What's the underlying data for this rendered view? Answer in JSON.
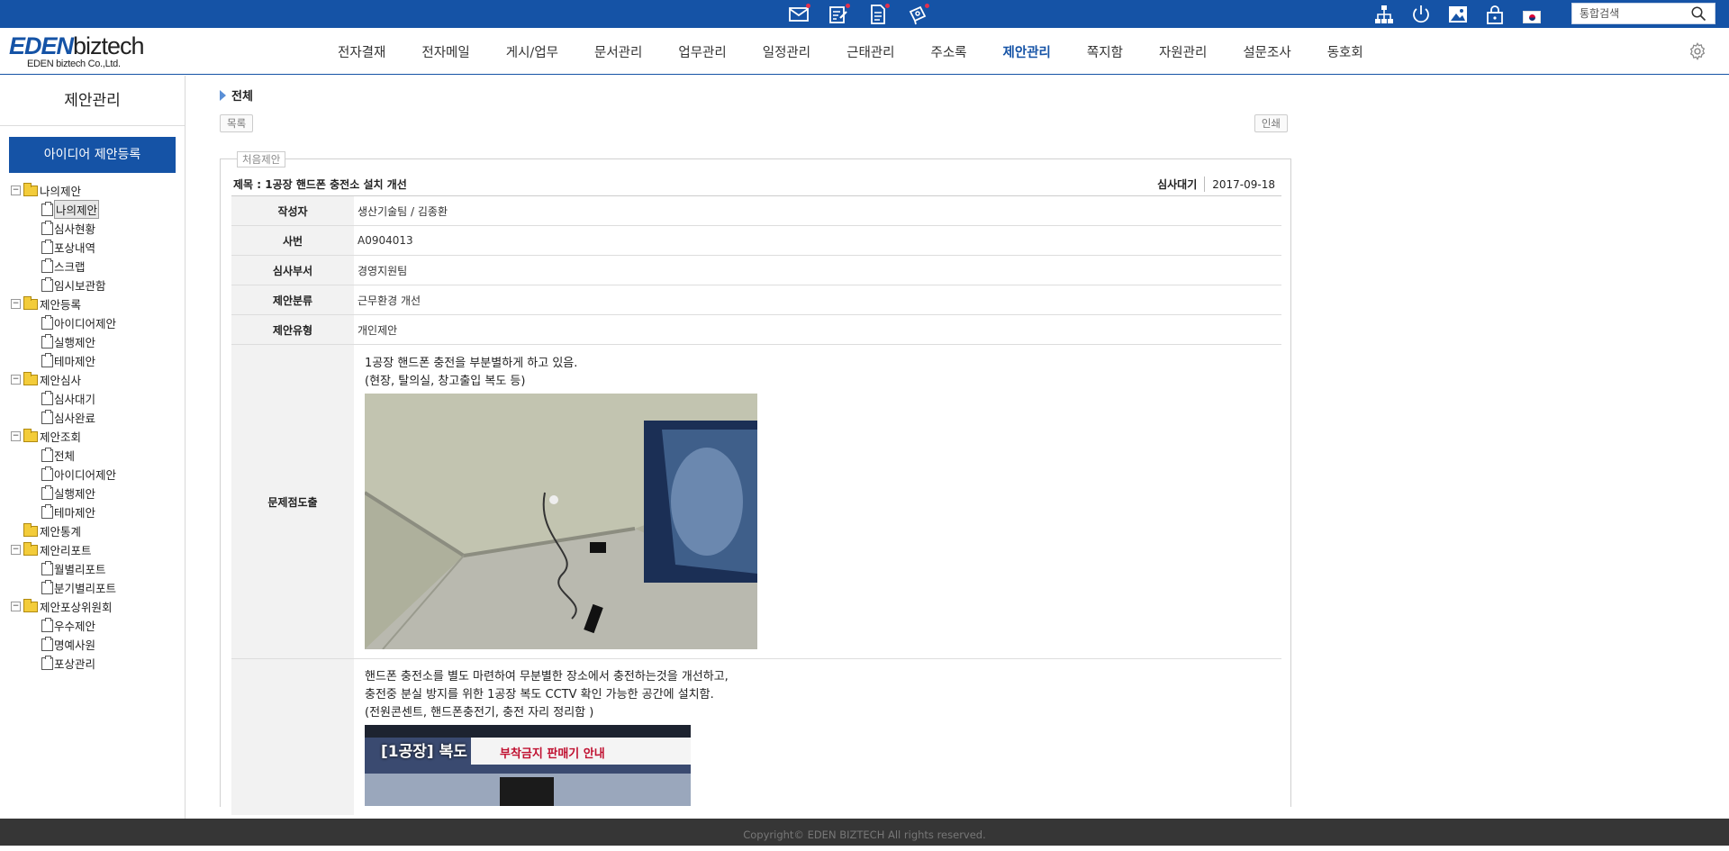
{
  "topbar": {
    "icons_center": [
      "mail-icon",
      "approval-edit-icon",
      "document-icon",
      "board-icon"
    ],
    "icons_right": [
      "org-chart-icon",
      "power-icon",
      "image-icon",
      "lock-icon",
      "korea-flag-icon"
    ],
    "search_placeholder": "통합검색"
  },
  "logo": {
    "brand_a": "EDEN",
    "brand_b": "biztech",
    "sub": "EDEN biztech Co.,Ltd."
  },
  "nav": [
    "전자결재",
    "전자메일",
    "게시/업무",
    "문서관리",
    "업무관리",
    "일정관리",
    "근태관리",
    "주소록",
    "제안관리",
    "쪽지함",
    "자원관리",
    "설문조사",
    "동호회"
  ],
  "nav_active": "제안관리",
  "sidebar": {
    "title": "제안관리",
    "register_button": "아이디어 제안등록",
    "tree": [
      {
        "label": "나의제안",
        "children": [
          "나의제안",
          "심사현황",
          "포상내역",
          "스크랩",
          "임시보관함"
        ]
      },
      {
        "label": "제안등록",
        "children": [
          "아이디어제안",
          "실행제안",
          "테마제안"
        ]
      },
      {
        "label": "제안심사",
        "children": [
          "심사대기",
          "심사완료"
        ]
      },
      {
        "label": "제안조회",
        "children": [
          "전체",
          "아이디어제안",
          "실행제안",
          "테마제안"
        ]
      },
      {
        "label": "제안통계",
        "children": []
      },
      {
        "label": "제안리포트",
        "children": [
          "월별리포트",
          "분기별리포트"
        ]
      },
      {
        "label": "제안포상위원회",
        "children": [
          "우수제안",
          "명예사원",
          "포상관리"
        ]
      }
    ],
    "selected": "나의제안"
  },
  "content": {
    "breadcrumb": "전체",
    "list_button": "목록",
    "print_button": "인쇄",
    "legend": "처음제안",
    "subject": "제목 : 1공장 핸드폰 충전소 설치 개선",
    "status": "심사대기",
    "date": "2017-09-18",
    "rows": [
      {
        "label": "작성자",
        "value": "생산기술팀 / 김종환"
      },
      {
        "label": "사번",
        "value": "A0904013"
      },
      {
        "label": "심사부서",
        "value": "경영지원팀"
      },
      {
        "label": "제안분류",
        "value": "근무환경 개선"
      },
      {
        "label": "제안유형",
        "value": "개인제안"
      }
    ],
    "problem": {
      "label": "문제점도출",
      "line1": "1공장 핸드폰 충전을 부분별하게 하고 있음.",
      "line2": "(현장, 탈의실, 창고출입 복도 등)"
    },
    "improvement": {
      "line1": "핸드폰 충전소를 별도 마련하여 무분별한 장소에서 충전하는것을 개선하고,",
      "line2": "충전중 분실 방지를 위한 1공장 복도 CCTV 확인 가능한 공간에 설치함.",
      "line3": "(전원콘센트, 핸드폰충전기, 충전 자리 정리함 )",
      "photo_caption": "[1공장] 복도"
    }
  },
  "footer": "Copyright© EDEN BIZTECH All rights reserved."
}
